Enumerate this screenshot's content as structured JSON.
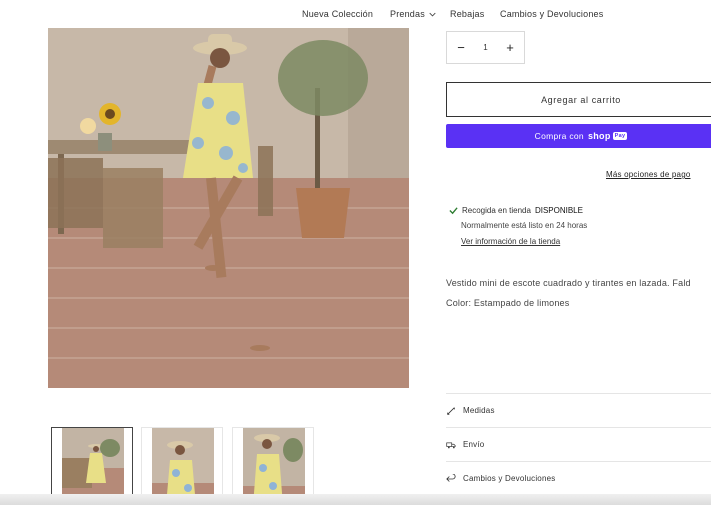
{
  "nav": {
    "items": [
      {
        "label": "Nueva Colección"
      },
      {
        "label": "Prendas",
        "icon": "chevron-down-icon"
      },
      {
        "label": "Rebajas"
      },
      {
        "label": "Cambios y Devoluciones"
      }
    ]
  },
  "product": {
    "quantity": {
      "minus": "−",
      "value": "1",
      "plus": "+"
    },
    "add_to_cart": "Agregar al carrito",
    "shop_pay": {
      "prefix": "Compra con",
      "brand": "shop",
      "pill": "Pay"
    },
    "more_payment": "Más opciones de pago",
    "pickup": {
      "prefix": "Recogida en tienda",
      "status": "DISPONIBLE",
      "ready": "Normalmente está listo en 24 horas",
      "link": "Ver información de la tienda"
    },
    "description": "Vestido mini de escote cuadrado y tirantes en lazada. Fald",
    "color": "Color: Estampado de limones"
  },
  "accordion": [
    {
      "label": "Medidas",
      "icon": "ruler-icon"
    },
    {
      "label": "Envío",
      "icon": "truck-icon"
    },
    {
      "label": "Cambios y Devoluciones",
      "icon": "return-icon"
    }
  ],
  "colors": {
    "shop_pay": "#5a31f4",
    "check": "#2e7d32"
  }
}
